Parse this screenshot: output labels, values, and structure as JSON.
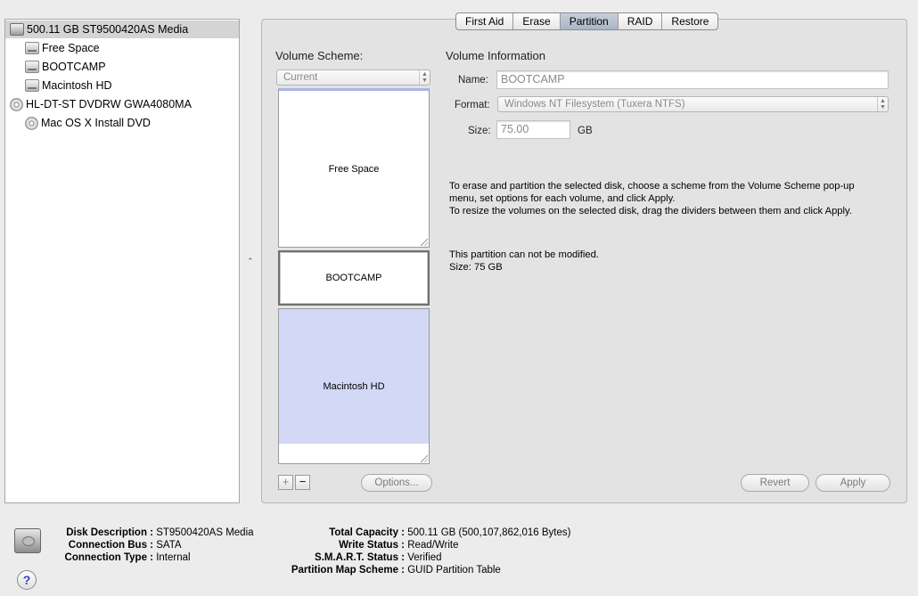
{
  "sidebar": {
    "items": [
      {
        "label": "500.11 GB ST9500420AS Media",
        "icon": "hard-disk-icon"
      },
      {
        "label": "Free Space",
        "icon": "volume-icon"
      },
      {
        "label": "BOOTCAMP",
        "icon": "volume-icon"
      },
      {
        "label": "Macintosh HD",
        "icon": "volume-icon"
      },
      {
        "label": "HL-DT-ST DVDRW GWA4080MA",
        "icon": "optical-drive-icon"
      },
      {
        "label": "Mac OS X Install DVD",
        "icon": "dvd-icon"
      }
    ]
  },
  "tabs": [
    "First Aid",
    "Erase",
    "Partition",
    "RAID",
    "Restore"
  ],
  "active_tab": "Partition",
  "volume_scheme": {
    "title": "Volume Scheme:",
    "selected": "Current",
    "partitions": [
      "Free Space",
      "BOOTCAMP",
      "Macintosh HD"
    ],
    "add_label": "+",
    "remove_label": "−",
    "options_label": "Options..."
  },
  "volume_info": {
    "title": "Volume Information",
    "name_label": "Name:",
    "name_value": "BOOTCAMP",
    "format_label": "Format:",
    "format_value": "Windows NT Filesystem (Tuxera NTFS)",
    "size_label": "Size:",
    "size_value": "75.00",
    "size_unit": "GB"
  },
  "instructions": {
    "line1": "To erase and partition the selected disk, choose a scheme from the Volume Scheme pop-up",
    "line2": "menu, set options for each volume, and click Apply.",
    "line3": "To resize the volumes on the selected disk, drag the dividers between them and click Apply."
  },
  "partition_note": {
    "line1": "This partition can not be modified.",
    "line2": "Size: 75 GB"
  },
  "buttons": {
    "revert": "Revert",
    "apply": "Apply"
  },
  "disk_info": {
    "disk_description_label": "Disk Description :",
    "disk_description": "ST9500420AS Media",
    "connection_bus_label": "Connection Bus :",
    "connection_bus": "SATA",
    "connection_type_label": "Connection Type :",
    "connection_type": "Internal",
    "total_capacity_label": "Total Capacity :",
    "total_capacity": "500.11 GB (500,107,862,016 Bytes)",
    "write_status_label": "Write Status :",
    "write_status": "Read/Write",
    "smart_status_label": "S.M.A.R.T. Status :",
    "smart_status": "Verified",
    "partition_map_label": "Partition Map Scheme :",
    "partition_map": "GUID Partition Table"
  },
  "help_label": "?"
}
